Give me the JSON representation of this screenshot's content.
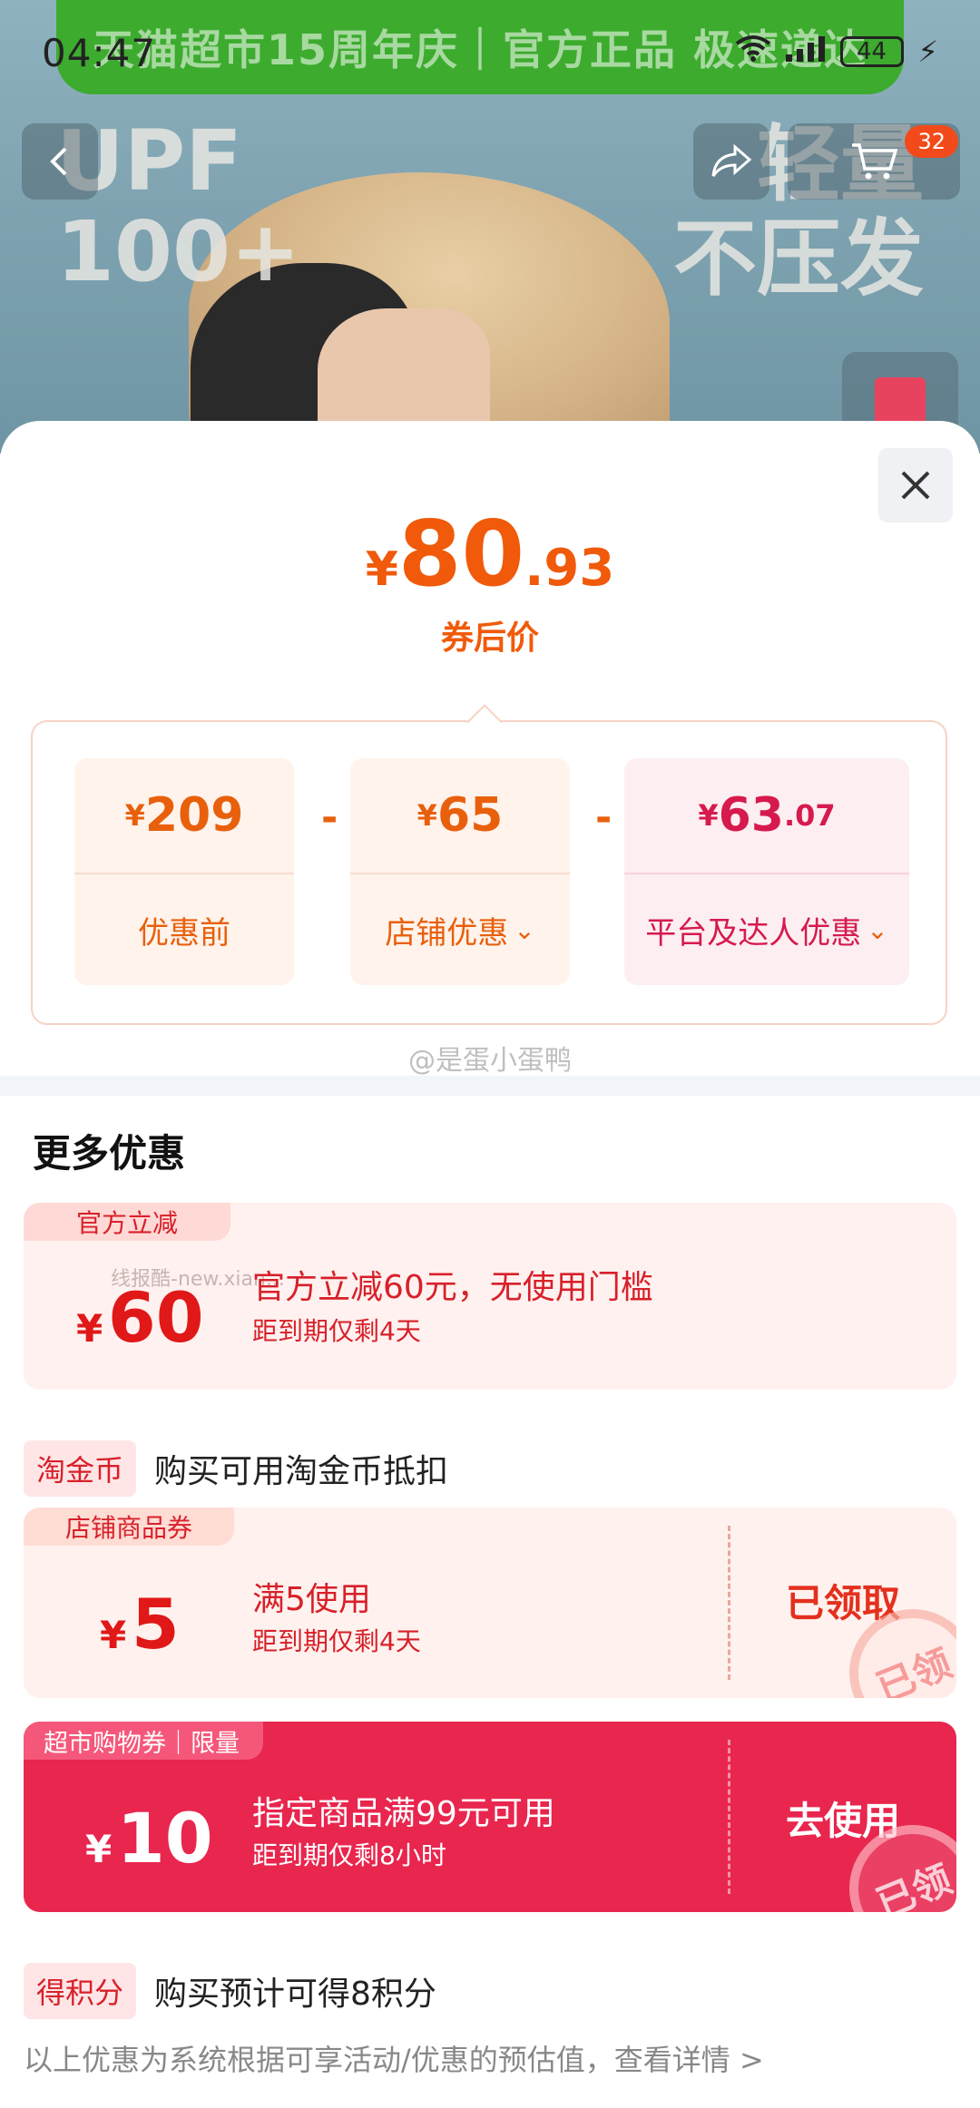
{
  "status_bar": {
    "time": "04:47",
    "battery": "44"
  },
  "hero": {
    "banner": "天猫超市15周年庆｜官方正品 极速递达",
    "text_left": [
      "UPF",
      "100+"
    ],
    "text_right": [
      "轻量",
      "不压发"
    ],
    "cart_count": "32"
  },
  "price_panel": {
    "currency": "¥",
    "final_int": "80",
    "final_dec": ".93",
    "final_label": "券后价",
    "breakdown": [
      {
        "value": "209",
        "label": "优惠前"
      },
      {
        "value": "65",
        "label": "店铺优惠"
      },
      {
        "value": "63",
        "value_dec": ".07",
        "label": "平台及达人优惠"
      }
    ],
    "minus": "-"
  },
  "watermark": "@是蛋小蛋鸭",
  "more": {
    "title": "更多优惠",
    "official": {
      "tag": "官方立减",
      "currency": "¥",
      "amount": "60",
      "desc": "官方立减60元，无使用门槛",
      "sub": "距到期仅剩4天",
      "watermark": "线报酷-new.xian..."
    },
    "taojinbi": {
      "badge": "淘金币",
      "text": "购买可用淘金币抵扣"
    },
    "store_coupon": {
      "tag": "店铺商品券",
      "currency": "¥",
      "amount": "5",
      "desc": "满5使用",
      "sub": "距到期仅剩4天",
      "action": "已领取",
      "stamp": "已领"
    },
    "market_coupon": {
      "tag": "超市购物券｜限量",
      "currency": "¥",
      "amount": "10",
      "desc": "指定商品满99元可用",
      "sub": "距到期仅剩8小时",
      "action": "去使用",
      "stamp": "已领"
    },
    "points": {
      "badge": "得积分",
      "text": "购买预计可得8积分"
    }
  },
  "footer_note": "以上优惠为系统根据可享活动/优惠的预估值，查看详情 >"
}
